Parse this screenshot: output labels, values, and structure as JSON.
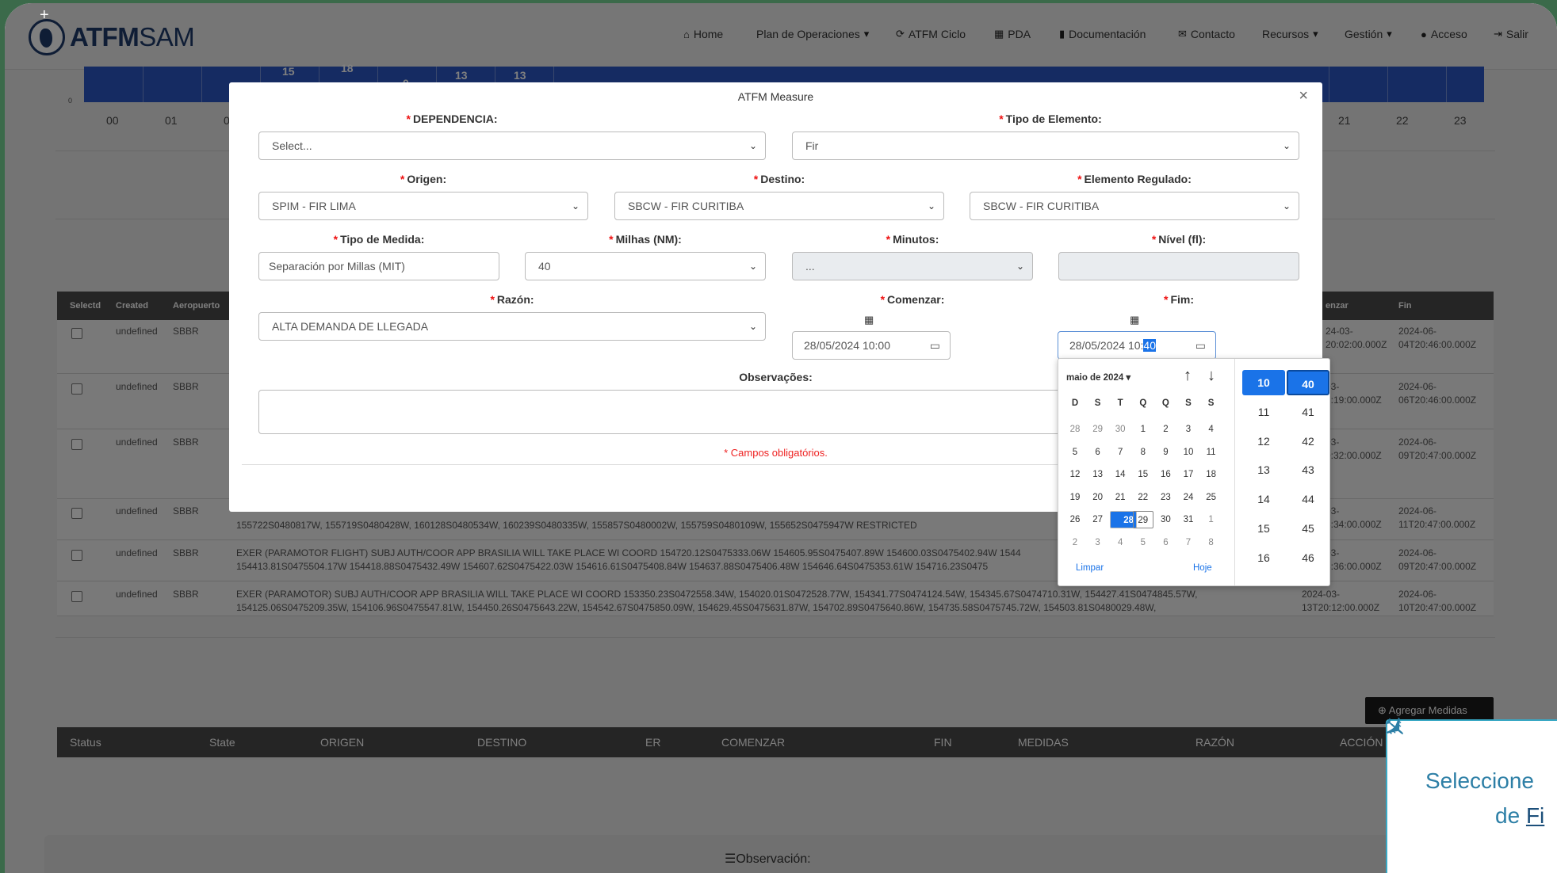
{
  "brand": {
    "name_bold": "ATFM",
    "name_light": "SAM"
  },
  "nav": {
    "items": [
      {
        "label": "Home",
        "icon": "home-icon",
        "glyph": "🏠"
      },
      {
        "label": "Plan de Operaciones",
        "icon": "caret-down-icon",
        "glyph": ""
      },
      {
        "label": "ATFM Ciclo",
        "icon": "refresh-icon",
        "glyph": "⟳"
      },
      {
        "label": "PDA",
        "icon": "table-icon",
        "glyph": "▦"
      },
      {
        "label": "Documentación",
        "icon": "book-icon",
        "glyph": "▮"
      },
      {
        "label": "Contacto",
        "icon": "envelope-icon",
        "glyph": "✉"
      },
      {
        "label": "Recursos",
        "icon": "caret-down-icon",
        "glyph": ""
      },
      {
        "label": "Gestión",
        "icon": "caret-down-icon",
        "glyph": ""
      },
      {
        "label": "Acceso",
        "icon": "user-icon",
        "glyph": "👤"
      },
      {
        "label": "Salir",
        "icon": "sign-out-icon",
        "glyph": "⇥"
      }
    ]
  },
  "chart": {
    "hours": [
      "00",
      "01",
      "0",
      "21",
      "22",
      "23"
    ],
    "bar_values": [
      "15",
      "18",
      "0",
      "13",
      "13"
    ],
    "y_zero": "0"
  },
  "table": {
    "headers": [
      "Selectd",
      "Created",
      "Aeropuerto",
      "enzar",
      "Fin"
    ],
    "rows": [
      {
        "created": "undefined",
        "airport": "SBBR",
        "start": "24-03-\n20:02:00.000Z",
        "end": "2024-06-\n04T20:46:00.000Z",
        "text": ""
      },
      {
        "created": "undefined",
        "airport": "SBBR",
        "start": "03-\n7:19:00.000Z",
        "end": "2024-06-\n06T20:46:00.000Z",
        "text": ""
      },
      {
        "created": "undefined",
        "airport": "SBBR",
        "start": "03-\n0:32:00.000Z",
        "end": "2024-06-\n09T20:47:00.000Z",
        "text": ""
      },
      {
        "created": "undefined",
        "airport": "SBBR",
        "start": "03-\n8:34:00.000Z",
        "end": "2024-06-\n11T20:47:00.000Z",
        "text": "155722S0480817W, 155719S0480428W, 160128S0480534W, 160239S0480335W, 155857S0480002W, 155759S0480109W, 155652S0475947W RESTRICTED"
      },
      {
        "created": "undefined",
        "airport": "SBBR",
        "start": "03-\n8:36:00.000Z",
        "end": "2024-06-\n09T20:47:00.000Z",
        "text": "EXER (PARAMOTOR FLIGHT) SUBJ AUTH/COOR APP BRASILIA WILL TAKE PLACE WI COORD 154720.12S0475333.06W 154605.95S0475407.89W 154600.03S0475402.94W 1544\n154413.81S0475504.17W 154418.88S0475432.49W 154607.62S0475422.03W 154616.61S0475408.84W 154637.88S0475406.48W 154646.64S0475353.61W 154716.23S0475"
      },
      {
        "created": "undefined",
        "airport": "SBBR",
        "start": "2024-03-\n13T20:12:00.000Z",
        "end": "2024-06-\n10T20:47:00.000Z",
        "text": "EXER (PARAMOTOR) SUBJ AUTH/COOR APP BRASILIA WILL TAKE PLACE WI COORD 153350.23S0472558.34W, 154020.01S0472528.77W, 154341.77S0474124.54W, 154345.67S0474710.31W, 154427.41S0474845.57W,\n154125.06S0475209.35W, 154106.96S0475547.81W, 154450.26S0475643.22W, 154542.67S0475850.09W, 154629.45S0475631.87W, 154702.89S0475640.86W, 154735.58S0475745.72W, 154503.81S0480029.48W,"
      }
    ]
  },
  "bottom_table": {
    "add_button": "Agregar Medidas",
    "headers": [
      "Status",
      "State",
      "ORIGEN",
      "DESTINO",
      "ER",
      "COMENZAR",
      "FIN",
      "MEDIDAS",
      "RAZÓN",
      "ACCIÓN"
    ]
  },
  "observation_title": "Observación:",
  "modal": {
    "title": "ATFM Measure",
    "close": "×",
    "required_mark": "*",
    "dependencia": {
      "label": "DEPENDENCIA:",
      "value": "Select..."
    },
    "tipo_elemento": {
      "label": "Tipo de Elemento:",
      "value": "Fir"
    },
    "origen": {
      "label": "Origen:",
      "value": "SPIM - FIR LIMA"
    },
    "destino": {
      "label": "Destino:",
      "value": "SBCW - FIR CURITIBA"
    },
    "elemento_regulado": {
      "label": "Elemento Regulado:",
      "value": "SBCW - FIR CURITIBA"
    },
    "tipo_medida": {
      "label": "Tipo de Medida:",
      "value": "Separación por Millas (MIT)"
    },
    "millas": {
      "label": "Milhas (NM):",
      "value": "40"
    },
    "minutos": {
      "label": "Minutos:",
      "value": "..."
    },
    "nivel": {
      "label": "Nível (fl):",
      "value": ""
    },
    "razon": {
      "label": "Razón:",
      "value": "ALTA DEMANDA DE LLEGADA"
    },
    "comenzar": {
      "label": "Comenzar:",
      "value": "28/05/2024 10:00"
    },
    "fim": {
      "label": "Fim:",
      "value_prefix": "28/05/2024 10:",
      "value_selected": "40"
    },
    "observacoes": {
      "label": "Observações:",
      "value": ""
    },
    "required_note": "* Campos obligatórios."
  },
  "datepicker": {
    "month": "maio de 2024 ▾",
    "weekdays": [
      "D",
      "S",
      "T",
      "Q",
      "Q",
      "S",
      "S"
    ],
    "weeks": [
      [
        "28",
        "29",
        "30",
        "1",
        "2",
        "3",
        "4"
      ],
      [
        "5",
        "6",
        "7",
        "8",
        "9",
        "10",
        "11"
      ],
      [
        "12",
        "13",
        "14",
        "15",
        "16",
        "17",
        "18"
      ],
      [
        "19",
        "20",
        "21",
        "22",
        "23",
        "24",
        "25"
      ],
      [
        "26",
        "27",
        "28",
        "29",
        "30",
        "31",
        "1"
      ],
      [
        "2",
        "3",
        "4",
        "5",
        "6",
        "7",
        "8"
      ]
    ],
    "clear": "Limpar",
    "today": "Hoje",
    "hours": [
      "10",
      "11",
      "12",
      "13",
      "14",
      "15",
      "16"
    ],
    "minutes": [
      "40",
      "41",
      "42",
      "43",
      "44",
      "45",
      "46"
    ]
  },
  "tooltip": {
    "line1": "Seleccione",
    "line2_prefix": "de ",
    "line2_link": "Fi"
  }
}
